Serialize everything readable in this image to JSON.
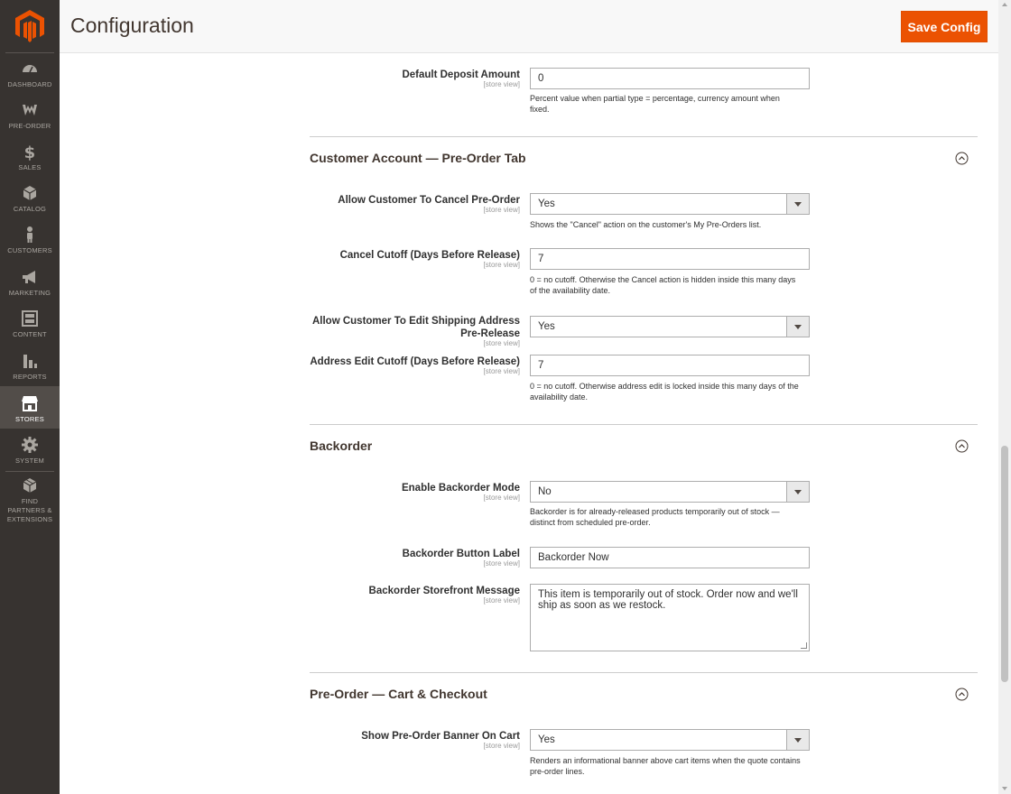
{
  "sidebar": {
    "items": [
      {
        "label": "DASHBOARD",
        "icon": "dashboard-icon"
      },
      {
        "label": "PRE-ORDER",
        "icon": "preorder-icon"
      },
      {
        "label": "SALES",
        "icon": "dollar-icon"
      },
      {
        "label": "CATALOG",
        "icon": "box-icon"
      },
      {
        "label": "CUSTOMERS",
        "icon": "person-icon"
      },
      {
        "label": "MARKETING",
        "icon": "megaphone-icon"
      },
      {
        "label": "CONTENT",
        "icon": "layout-icon"
      },
      {
        "label": "REPORTS",
        "icon": "bar-chart-icon"
      },
      {
        "label": "STORES",
        "icon": "storefront-icon",
        "active": true
      },
      {
        "label": "SYSTEM",
        "icon": "gear-icon"
      },
      {
        "label": "FIND PARTNERS & EXTENSIONS",
        "icon": "cube-icon"
      }
    ]
  },
  "header": {
    "title": "Configuration",
    "save_label": "Save Config"
  },
  "scope_label": "[store view]",
  "fields": {
    "default_deposit": {
      "label": "Default Deposit Amount",
      "value": "0",
      "note": "Percent value when partial type = percentage, currency amount when fixed."
    },
    "allow_cancel": {
      "label": "Allow Customer To Cancel Pre-Order",
      "value": "Yes",
      "note": "Shows the \"Cancel\" action on the customer's My Pre-Orders list."
    },
    "cancel_cutoff": {
      "label": "Cancel Cutoff (Days Before Release)",
      "value": "7",
      "note": "0 = no cutoff. Otherwise the Cancel action is hidden inside this many days of the availability date."
    },
    "allow_edit_address": {
      "label": "Allow Customer To Edit Shipping Address Pre-Release",
      "value": "Yes"
    },
    "address_cutoff": {
      "label": "Address Edit Cutoff (Days Before Release)",
      "value": "7",
      "note": "0 = no cutoff. Otherwise address edit is locked inside this many days of the availability date."
    },
    "enable_backorder": {
      "label": "Enable Backorder Mode",
      "value": "No",
      "note": "Backorder is for already-released products temporarily out of stock — distinct from scheduled pre-order."
    },
    "backorder_button": {
      "label": "Backorder Button Label",
      "value": "Backorder Now"
    },
    "backorder_message": {
      "label": "Backorder Storefront Message",
      "value": "This item is temporarily out of stock. Order now and we'll ship as soon as we restock."
    },
    "show_banner": {
      "label": "Show Pre-Order Banner On Cart",
      "value": "Yes",
      "note": "Renders an informational banner above cart items when the quote contains pre-order lines."
    }
  },
  "sections": {
    "customer_account": "Customer Account — Pre-Order Tab",
    "backorder": "Backorder",
    "cart_checkout": "Pre-Order — Cart & Checkout"
  },
  "colors": {
    "accent": "#eb5202",
    "sidebar_bg": "#373330",
    "sidebar_active": "#524d49"
  }
}
